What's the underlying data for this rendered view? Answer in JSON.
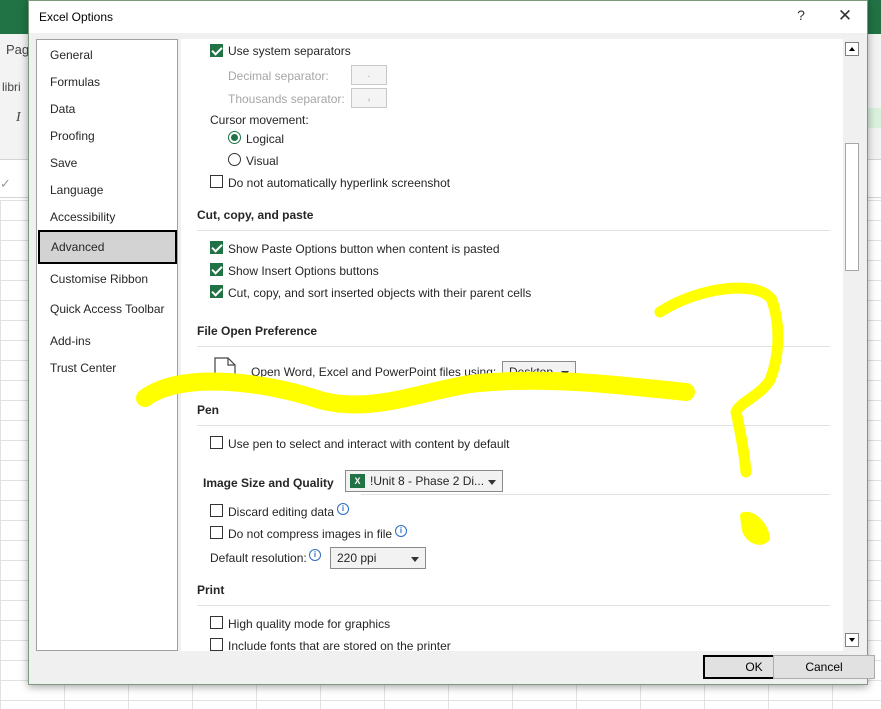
{
  "background": {
    "ribbon_tab_partial": "Pag",
    "font_partial": "libri",
    "italic_glyph": "I"
  },
  "dialog": {
    "title": "Excel Options",
    "help_label": "?",
    "close_label": "✕"
  },
  "sidebar": {
    "items": [
      {
        "label": "General"
      },
      {
        "label": "Formulas"
      },
      {
        "label": "Data"
      },
      {
        "label": "Proofing"
      },
      {
        "label": "Save"
      },
      {
        "label": "Language"
      },
      {
        "label": "Accessibility"
      },
      {
        "label": "Advanced"
      },
      {
        "label": "Customise Ribbon"
      },
      {
        "label": "Quick Access Toolbar"
      },
      {
        "label": "Add-ins"
      },
      {
        "label": "Trust Center"
      }
    ],
    "active": "Advanced"
  },
  "content": {
    "use_system_separators": {
      "label": "Use system separators",
      "checked": true
    },
    "decimal_separator": {
      "label": "Decimal separator:",
      "value": "."
    },
    "thousands_separator": {
      "label": "Thousands separator:",
      "value": ","
    },
    "cursor_movement": {
      "label": "Cursor movement:",
      "options": [
        {
          "label": "Logical",
          "selected": true
        },
        {
          "label": "Visual",
          "selected": false
        }
      ]
    },
    "no_hyperlink_screenshot": {
      "label": "Do not automatically hyperlink screenshot",
      "checked": false
    },
    "cut_copy_paste": {
      "title": "Cut, copy, and paste",
      "options": [
        {
          "label": "Show Paste Options button when content is pasted",
          "checked": true
        },
        {
          "label": "Show Insert Options buttons",
          "checked": true
        },
        {
          "label": "Cut, copy, and sort inserted objects with their parent cells",
          "checked": true
        }
      ]
    },
    "file_open": {
      "title": "File Open Preference",
      "label": "Open Word, Excel and PowerPoint files using:",
      "value": "Desktop"
    },
    "pen": {
      "title": "Pen",
      "option": {
        "label": "Use pen to select and interact with content by default",
        "checked": false
      }
    },
    "image_size": {
      "title": "Image Size and Quality",
      "file_value": "!Unit 8 - Phase 2 Di...",
      "discard_editing": {
        "label": "Discard editing data",
        "checked": false
      },
      "no_compress": {
        "label": "Do not compress images in file",
        "checked": false
      },
      "default_resolution": {
        "label": "Default resolution:",
        "value": "220 ppi"
      }
    },
    "print": {
      "title": "Print",
      "options": [
        {
          "label": "High quality mode for graphics",
          "checked": false
        },
        {
          "label": "Include fonts that are stored on the printer",
          "checked": false
        }
      ]
    }
  },
  "buttons": {
    "ok": "OK",
    "cancel": "Cancel"
  },
  "colors": {
    "accent": "#217346",
    "annotation": "#ffff00"
  }
}
